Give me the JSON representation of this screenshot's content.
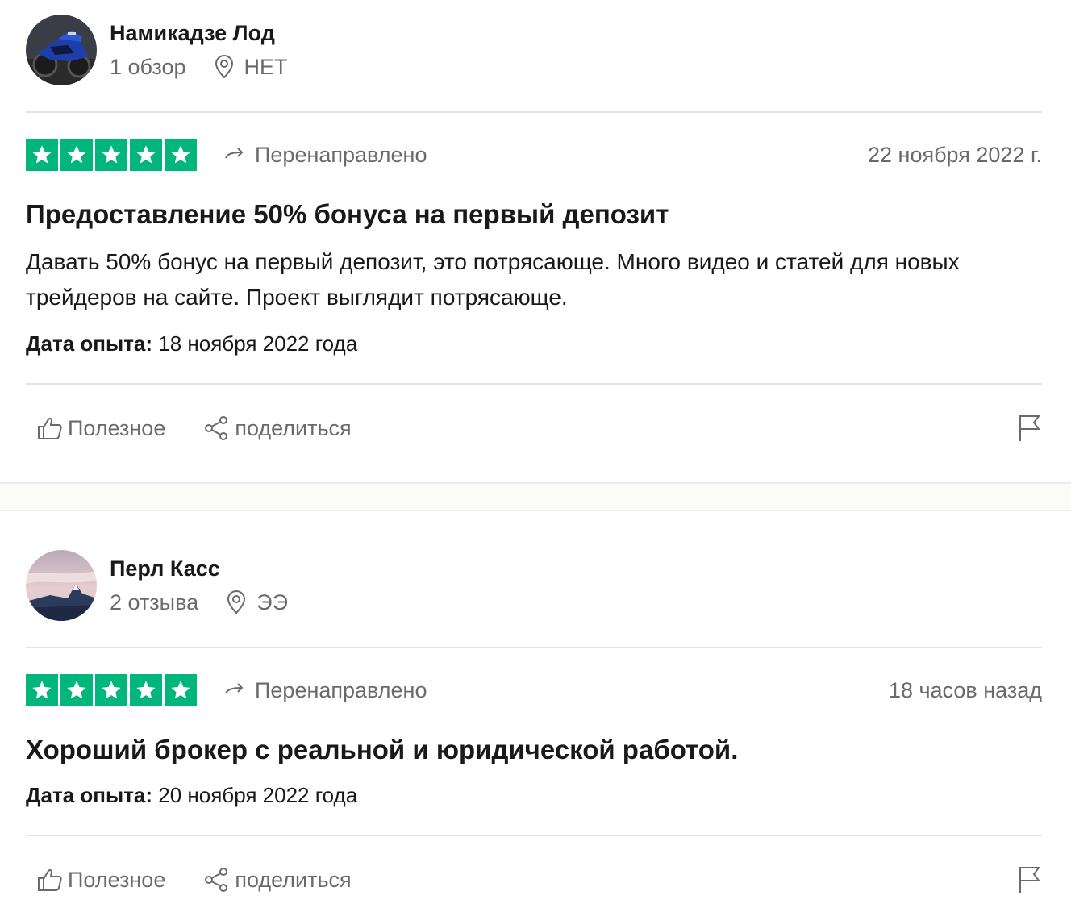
{
  "colors": {
    "star_green": "#00b67a",
    "muted": "#696a6a",
    "text": "#191919"
  },
  "reviews": [
    {
      "user": {
        "name": "Намикадзе Лод",
        "reviews_count": "1 обзор",
        "location": "НЕТ",
        "avatar": "motorcycle-photo"
      },
      "rating": 5,
      "status": "Перенаправлено",
      "date": "22 ноября 2022 г.",
      "title": "Предоставление 50% бонуса на первый депозит",
      "body": "Давать 50% бонус на первый депозит, это потрясающе. Много видео и статей для новых трейдеров на сайте. Проект выглядит потрясающе.",
      "experience_label": "Дата опыта:",
      "experience_date": " 18 ноября 2022 года",
      "helpful_label": "Полезное",
      "share_label": "поделиться"
    },
    {
      "user": {
        "name": "Перл Касс",
        "reviews_count": "2 отзыва",
        "location": "ЭЭ",
        "avatar": "mountain-photo"
      },
      "rating": 5,
      "status": "Перенаправлено",
      "date": "18 часов назад",
      "title": "Хороший брокер с реальной и юридической работой.",
      "experience_label": "Дата опыта:",
      "experience_date": " 20 ноября 2022 года",
      "helpful_label": "Полезное",
      "share_label": "поделиться"
    }
  ]
}
